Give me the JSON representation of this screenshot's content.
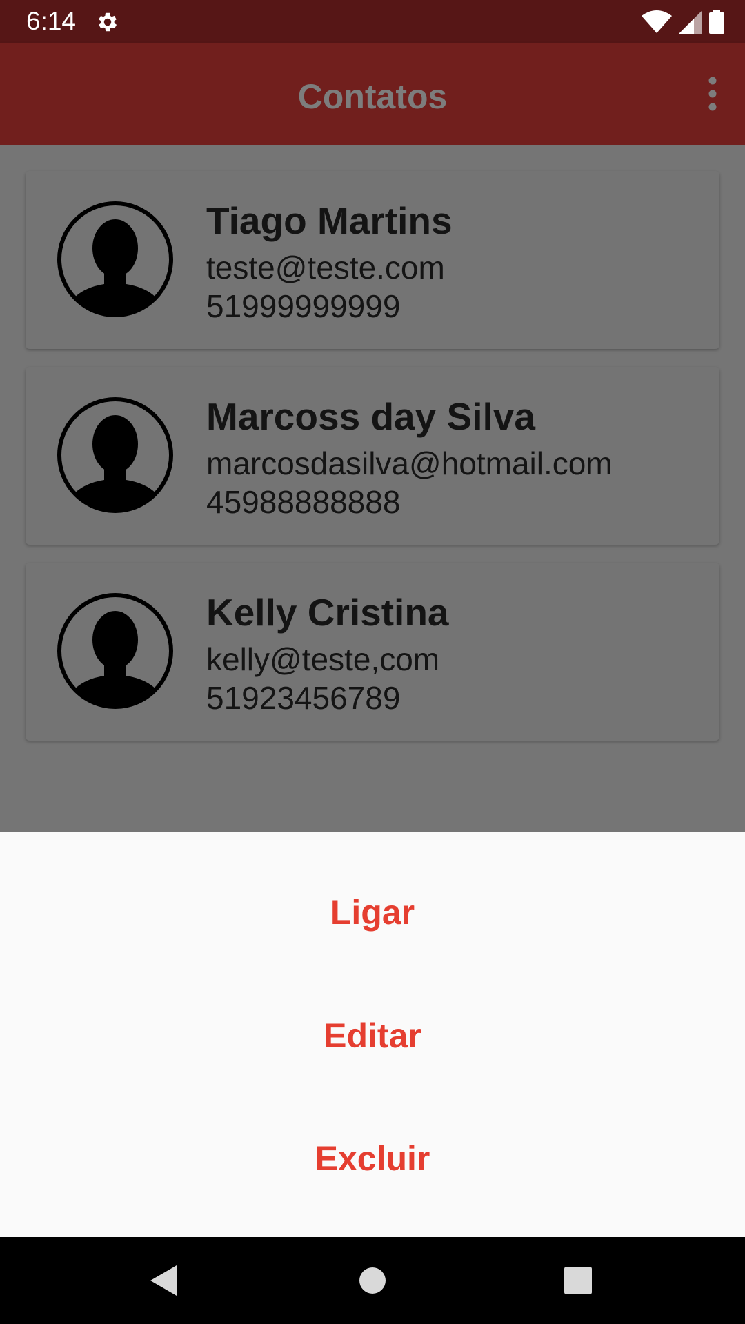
{
  "status_bar": {
    "time": "6:14",
    "icons": [
      "settings-icon",
      "wifi-icon",
      "signal-icon",
      "battery-icon"
    ]
  },
  "app_bar": {
    "title": "Contatos",
    "menu_icon": "more-vert-icon"
  },
  "contacts": [
    {
      "name": "Tiago Martins",
      "email": "teste@teste.com",
      "phone": "51999999999"
    },
    {
      "name": "Marcoss day Silva",
      "email": "marcosdasilva@hotmail.com",
      "phone": "45988888888"
    },
    {
      "name": "Kelly Cristina",
      "email": "kelly@teste,com",
      "phone": "51923456789"
    }
  ],
  "bottom_sheet": {
    "actions": [
      "Ligar",
      "Editar",
      "Excluir"
    ]
  },
  "nav_bar": {
    "icons": [
      "back-icon",
      "home-icon",
      "recents-icon"
    ]
  },
  "colors": {
    "status_bar": "#561616",
    "app_bar": "#711f1d",
    "scrim_background": "#757575",
    "action_text": "#e53e30",
    "sheet_background": "#fafafa"
  }
}
